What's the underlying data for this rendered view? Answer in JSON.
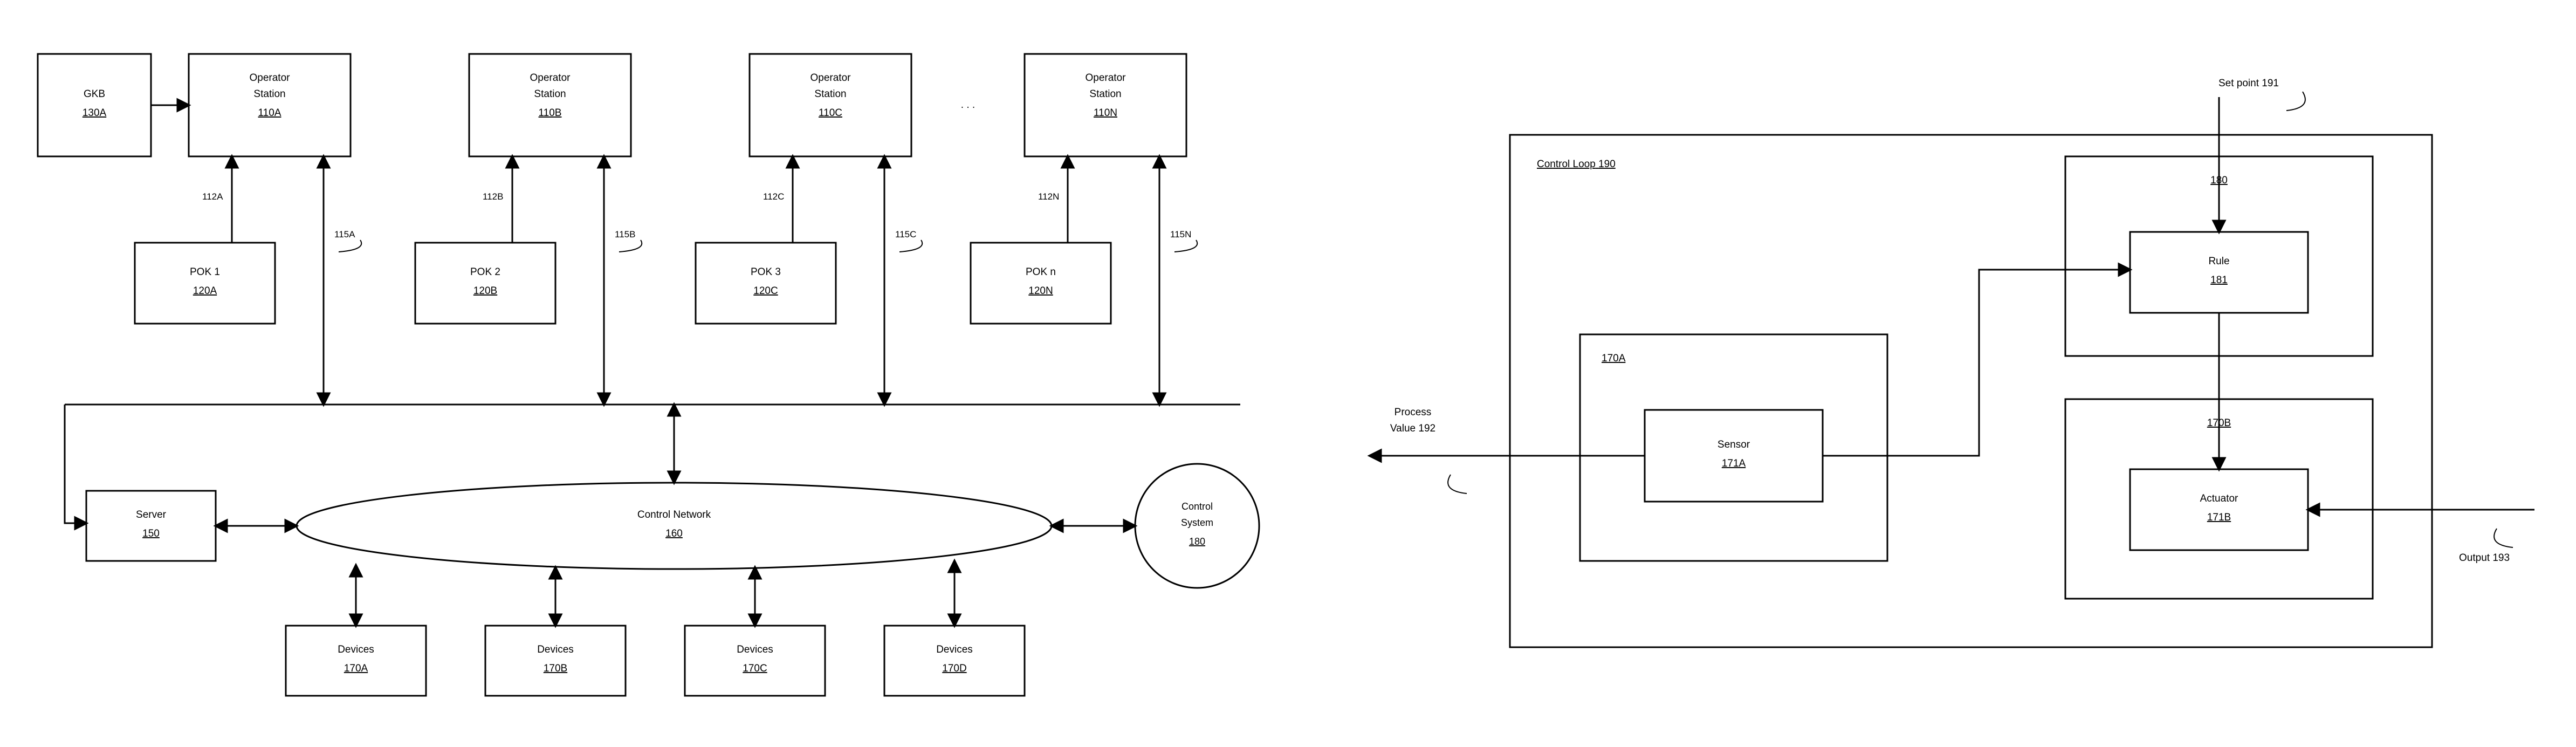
{
  "left": {
    "gkb": {
      "title": "GKB",
      "id": "130A"
    },
    "ops": [
      {
        "title1": "Operator",
        "title2": "Station",
        "id": "110A"
      },
      {
        "title1": "Operator",
        "title2": "Station",
        "id": "110B"
      },
      {
        "title1": "Operator",
        "title2": "Station",
        "id": "110C"
      },
      {
        "title1": "Operator",
        "title2": "Station",
        "id": "110N"
      }
    ],
    "ellipsis": ". . .",
    "pok": [
      {
        "title": "POK 1",
        "id": "120A"
      },
      {
        "title": "POK 2",
        "id": "120B"
      },
      {
        "title": "POK 3",
        "id": "120C"
      },
      {
        "title": "POK n",
        "id": "120N"
      }
    ],
    "edge112": [
      "112A",
      "112B",
      "112C",
      "112N"
    ],
    "edge115": [
      "115A",
      "115B",
      "115C",
      "115N"
    ],
    "server": {
      "title": "Server",
      "id": "150"
    },
    "network": {
      "title": "Control Network",
      "id": "160"
    },
    "system": {
      "title1": "Control",
      "title2": "System",
      "id": "180"
    },
    "devices": [
      {
        "title": "Devices",
        "id": "170A"
      },
      {
        "title": "Devices",
        "id": "170B"
      },
      {
        "title": "Devices",
        "id": "170C"
      },
      {
        "title": "Devices",
        "id": "170D"
      }
    ]
  },
  "right": {
    "loop": {
      "title": "Control Loop",
      "id": "190"
    },
    "setpoint": {
      "label": "Set point",
      "id": "191"
    },
    "process": {
      "label1": "Process",
      "label2": "Value",
      "id": "192"
    },
    "output": {
      "label": "Output",
      "id": "193"
    },
    "boxA": {
      "id": "170A",
      "inner_title": "Sensor",
      "inner_id": "171A"
    },
    "boxCtrl": {
      "id": "180",
      "inner_title": "Rule",
      "inner_id": "181"
    },
    "boxB": {
      "id": "170B",
      "inner_title": "Actuator",
      "inner_id": "171B"
    }
  }
}
